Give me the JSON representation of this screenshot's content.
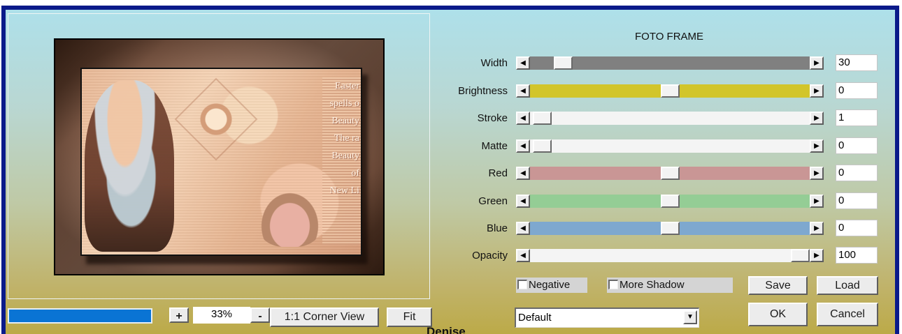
{
  "title": "FOTO FRAME",
  "preview": {
    "text_lines": [
      "Easter",
      "spells o",
      "Beauty",
      "The ra",
      "Beauty",
      "of",
      "New Li"
    ]
  },
  "progress": {
    "value_percent": 100
  },
  "zoom": {
    "plus_label": "+",
    "value": "33%",
    "minus_label": "-",
    "corner_view_label": "1:1 Corner View",
    "fit_label": "Fit"
  },
  "watermark": "Denise",
  "sliders": [
    {
      "label": "Width",
      "value": "30",
      "position": 0.09,
      "track_color": "#808080"
    },
    {
      "label": "Brightness",
      "value": "0",
      "position": 0.5,
      "track_color": "#d2c52a"
    },
    {
      "label": "Stroke",
      "value": "1",
      "position": 0.01,
      "track_color": "#f4f4f4"
    },
    {
      "label": "Matte",
      "value": "0",
      "position": 0.01,
      "track_color": "#f4f4f4"
    },
    {
      "label": "Red",
      "value": "0",
      "position": 0.5,
      "track_color": "#c99695"
    },
    {
      "label": "Green",
      "value": "0",
      "position": 0.5,
      "track_color": "#94cd95"
    },
    {
      "label": "Blue",
      "value": "0",
      "position": 0.5,
      "track_color": "#7ea8cf"
    },
    {
      "label": "Opacity",
      "value": "100",
      "position": 1.0,
      "track_color": "#f4f4f4"
    }
  ],
  "options": {
    "negative_label": "Negative",
    "more_shadow_label": "More Shadow"
  },
  "buttons": {
    "save": "Save",
    "load": "Load",
    "ok": "OK",
    "cancel": "Cancel"
  },
  "preset": {
    "selected": "Default"
  },
  "icons": {
    "left_arrow": "left-arrow-icon",
    "right_arrow": "right-arrow-icon",
    "dropdown": "chevron-down-icon"
  }
}
